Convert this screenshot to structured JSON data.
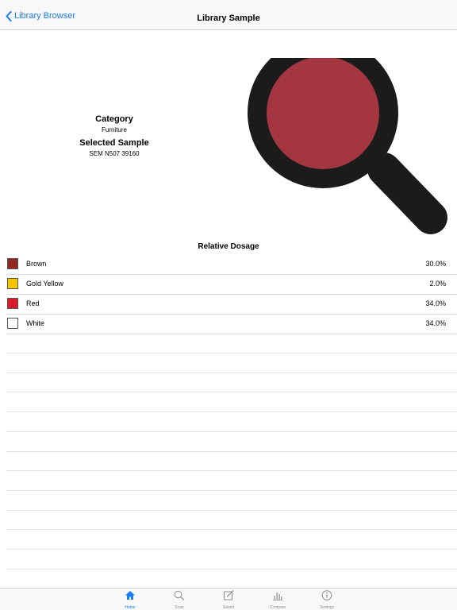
{
  "nav": {
    "back_label": "Library Browser",
    "title": "Library Sample"
  },
  "info": {
    "category_label": "Category",
    "category_value": "Furniture",
    "sample_label": "Selected Sample",
    "sample_value": "SEM N507 39160"
  },
  "sample_color": "#a33641",
  "section_title": "Relative Dosage",
  "dosage": [
    {
      "name": "Brown",
      "percent": "30.0%",
      "color": "#8e2a22"
    },
    {
      "name": "Gold Yellow",
      "percent": "2.0%",
      "color": "#f5c400"
    },
    {
      "name": "Red",
      "percent": "34.0%",
      "color": "#d81b2a"
    },
    {
      "name": "White",
      "percent": "34.0%",
      "color": "#ffffff"
    }
  ],
  "tabs": [
    {
      "label": "Home",
      "icon": "home-icon",
      "active": true
    },
    {
      "label": "Scan",
      "icon": "search-icon",
      "active": false
    },
    {
      "label": "Saved",
      "icon": "edit-icon",
      "active": false
    },
    {
      "label": "Compare",
      "icon": "bar-chart-icon",
      "active": false
    },
    {
      "label": "Settings",
      "icon": "info-icon",
      "active": false
    }
  ]
}
